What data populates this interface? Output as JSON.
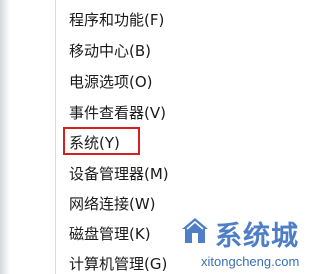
{
  "context_menu": {
    "items": [
      {
        "label": "程序和功能(F)"
      },
      {
        "label": "移动中心(B)"
      },
      {
        "label": "电源选项(O)"
      },
      {
        "label": "事件查看器(V)"
      },
      {
        "label": "系统(Y)"
      },
      {
        "label": "设备管理器(M)"
      },
      {
        "label": "网络连接(W)"
      },
      {
        "label": "磁盘管理(K)"
      },
      {
        "label": "计算机管理(G)"
      }
    ],
    "highlighted_item": "系统(Y)",
    "highlight_color": "#d42020"
  },
  "watermark": {
    "title": "系统城",
    "url": "xitongcheng.com",
    "color": "#4e7fc6"
  }
}
